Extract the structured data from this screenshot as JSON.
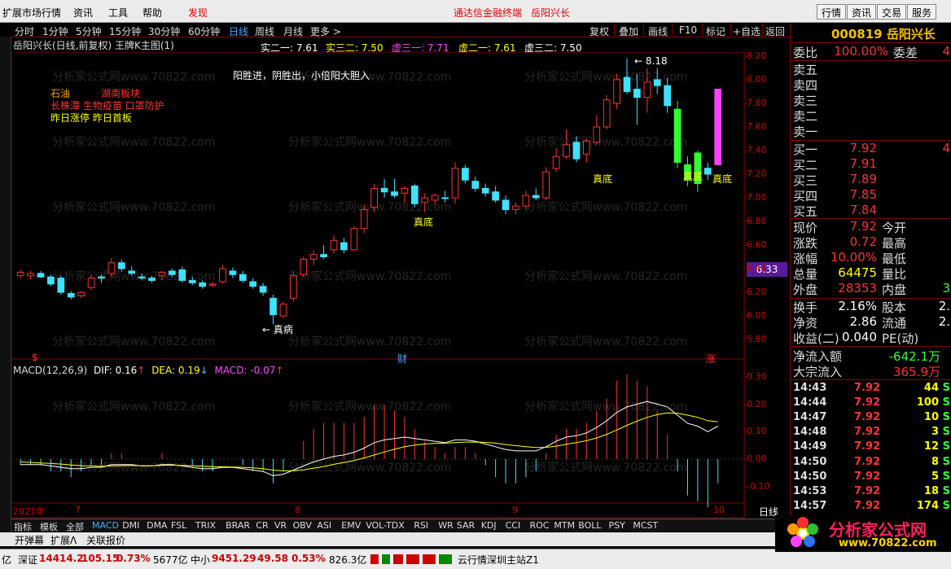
{
  "app": {
    "menus": [
      "扩展市场行情",
      "资讯",
      "工具",
      "帮助",
      "发现"
    ],
    "center_title": "通达信金融终端",
    "center_stock": "岳阳兴长",
    "right_buttons": [
      "行情",
      "资讯",
      "交易",
      "服务"
    ]
  },
  "timeframes": [
    "分时",
    "1分钟",
    "5分钟",
    "15分钟",
    "30分钟",
    "60分钟",
    "日线",
    "周线",
    "月线",
    "更多 >"
  ],
  "selected_tf": "日线",
  "toolbar_right": [
    "复权",
    "叠加",
    "画线",
    "F10",
    "标记",
    "+自选",
    "返回"
  ],
  "chart_title": "岳阳兴长(日线,前复权) 王牌K主图(1)",
  "indicators": [
    {
      "label": "实二一: 7.61",
      "color": "#ffffff"
    },
    {
      "label": "实三二: 7.50",
      "color": "#ffff00"
    },
    {
      "label": "虚三一: 7.71",
      "color": "#ff40ff"
    },
    {
      "label": "虚二一: 7.61",
      "color": "#ffff00"
    },
    {
      "label": "虚三二: 7.50",
      "color": "#ffffff"
    }
  ],
  "notes": {
    "slogan": "阳胜进，阴胜出，小倍阳大胆入",
    "sector1": "石油",
    "sector2": "湖南板块",
    "sector3": "长株潭 生物疫苗 口罩防护",
    "sector4": "昨日涨停 昨日首板",
    "high_label": "8.18",
    "price_box": "6.33",
    "zhendi1": "真底",
    "zhendi2": "真底",
    "zhendi3": "真底",
    "zhendi4": "真底",
    "zhenbing": "真病",
    "marker_s": "$",
    "marker_cai": "财",
    "marker_zhang": "涨"
  },
  "watermark": "分析家公式网www.70822.com",
  "y_axis": [
    "8.20",
    "8.00",
    "7.80",
    "7.60",
    "7.40",
    "7.20",
    "7.00",
    "6.80",
    "6.60",
    "6.40",
    "6.20",
    "6.00",
    "5.80"
  ],
  "macd": {
    "title": "MACD(12,26,9)",
    "dif": "DIF: 0.16",
    "dea": "DEA: 0.19",
    "macd": "MACD: -0.07",
    "axis": [
      "0.30",
      "0.20",
      "0.10",
      "0.00",
      "-0.10"
    ]
  },
  "x_axis": [
    "2021年",
    "7",
    "8",
    "9",
    "10"
  ],
  "x_right": "日线",
  "bottom_tabs": [
    "指标",
    "模板",
    "全部",
    "MACD",
    "DMI",
    "DMA",
    "FSL",
    "TRIX",
    "BRAR",
    "CR",
    "VR",
    "OBV",
    "ASI",
    "EMV",
    "VOL-TDX",
    "RSI",
    "WR",
    "SAR",
    "KDJ",
    "CCI",
    "ROC",
    "MTM",
    "BOLL",
    "PSY",
    "MCST"
  ],
  "selected_tab": "MACD",
  "bottom2": [
    "开弹幕",
    "扩展Λ",
    "关联报价"
  ],
  "status": {
    "a": "亿",
    "sz_label": "深证",
    "sz": "14414.2",
    "sz_chg": "105.15",
    "sz_pct": "0.73%",
    "sz_amt": "5677亿",
    "zx_label": "中小",
    "zx": "9451.29",
    "zx_chg": "49.58",
    "zx_pct": "0.53%",
    "zx_amt": "826.3亿",
    "server": "云行情深圳主站Z1"
  },
  "right_panel": {
    "code": "000819 岳阳兴长",
    "weibi_label": "委比",
    "weibi": "100.00%",
    "weicha_label": "委差",
    "weicha": "4",
    "sells": [
      "卖五",
      "卖四",
      "卖三",
      "卖二",
      "卖一"
    ],
    "buys": [
      {
        "l": "买一",
        "p": "7.92",
        "v": "4"
      },
      {
        "l": "买二",
        "p": "7.91",
        "v": ""
      },
      {
        "l": "买三",
        "p": "7.89",
        "v": ""
      },
      {
        "l": "买四",
        "p": "7.85",
        "v": ""
      },
      {
        "l": "买五",
        "p": "7.84",
        "v": ""
      }
    ],
    "stats": [
      {
        "l": "现价",
        "v": "7.92",
        "c": "red",
        "l2": "今开",
        "v2": ""
      },
      {
        "l": "涨跌",
        "v": "0.72",
        "c": "red",
        "l2": "最高",
        "v2": ""
      },
      {
        "l": "涨幅",
        "v": "10.00%",
        "c": "red",
        "l2": "最低",
        "v2": ""
      },
      {
        "l": "总量",
        "v": "64475",
        "c": "yel",
        "l2": "量比",
        "v2": ""
      },
      {
        "l": "外盘",
        "v": "28353",
        "c": "red",
        "l2": "内盘",
        "v2": "3"
      }
    ],
    "stats2": [
      {
        "l": "换手",
        "v": "2.16%",
        "c": "wht",
        "l2": "股本",
        "v2": "2."
      },
      {
        "l": "净资",
        "v": "2.86",
        "c": "wht",
        "l2": "流通",
        "v2": "2."
      },
      {
        "l": "收益(二)",
        "v": "0.040",
        "c": "wht",
        "l2": "PE(动)",
        "v2": ""
      }
    ],
    "flows": [
      {
        "l": "净流入额",
        "v": "-642.1万",
        "c": "grn"
      },
      {
        "l": "大宗流入",
        "v": "365.9万",
        "c": "red"
      }
    ],
    "ticks": [
      {
        "t": "14:43",
        "p": "7.92",
        "q": "44",
        "f": "S"
      },
      {
        "t": "14:44",
        "p": "7.92",
        "q": "100",
        "f": "S"
      },
      {
        "t": "14:47",
        "p": "7.92",
        "q": "10",
        "f": "S"
      },
      {
        "t": "14:48",
        "p": "7.92",
        "q": "3",
        "f": "S"
      },
      {
        "t": "14:49",
        "p": "7.92",
        "q": "12",
        "f": "S"
      },
      {
        "t": "14:50",
        "p": "7.92",
        "q": "8",
        "f": "S"
      },
      {
        "t": "14:50",
        "p": "7.92",
        "q": "5",
        "f": "S"
      },
      {
        "t": "14:53",
        "p": "7.92",
        "q": "18",
        "f": "S"
      },
      {
        "t": "14:57",
        "p": "7.92",
        "q": "174",
        "f": "S"
      }
    ]
  },
  "logo": {
    "text": "分析家公式网",
    "url": "www.70822.com"
  },
  "chart_data": {
    "type": "candlestick",
    "ylim": [
      5.78,
      8.22
    ],
    "candles": [
      [
        6.37,
        6.39,
        6.32,
        6.34
      ],
      [
        6.34,
        6.38,
        6.31,
        6.36
      ],
      [
        6.36,
        6.38,
        6.32,
        6.33
      ],
      [
        6.33,
        6.35,
        6.25,
        6.27
      ],
      [
        6.32,
        6.34,
        6.18,
        6.2
      ],
      [
        6.19,
        6.21,
        6.14,
        6.16
      ],
      [
        6.17,
        6.21,
        6.15,
        6.2
      ],
      [
        6.24,
        6.35,
        6.22,
        6.32
      ],
      [
        6.32,
        6.35,
        6.28,
        6.33
      ],
      [
        6.36,
        6.49,
        6.33,
        6.45
      ],
      [
        6.45,
        6.48,
        6.37,
        6.4
      ],
      [
        6.38,
        6.42,
        6.34,
        6.36
      ],
      [
        6.33,
        6.36,
        6.3,
        6.32
      ],
      [
        6.32,
        6.34,
        6.28,
        6.3
      ],
      [
        6.34,
        6.38,
        6.3,
        6.37
      ],
      [
        6.38,
        6.4,
        6.33,
        6.35
      ],
      [
        6.39,
        6.42,
        6.28,
        6.3
      ],
      [
        6.3,
        6.33,
        6.26,
        6.28
      ],
      [
        6.28,
        6.3,
        6.23,
        6.25
      ],
      [
        6.26,
        6.29,
        6.24,
        6.27
      ],
      [
        6.29,
        6.43,
        6.27,
        6.4
      ],
      [
        6.38,
        6.41,
        6.32,
        6.35
      ],
      [
        6.35,
        6.38,
        6.28,
        6.3
      ],
      [
        6.29,
        6.32,
        6.23,
        6.25
      ],
      [
        6.25,
        6.28,
        6.17,
        6.2
      ],
      [
        6.15,
        6.18,
        5.93,
        6.01
      ],
      [
        6.0,
        6.12,
        5.98,
        6.1
      ],
      [
        6.15,
        6.38,
        6.12,
        6.34
      ],
      [
        6.35,
        6.5,
        6.33,
        6.48
      ],
      [
        6.48,
        6.56,
        6.43,
        6.52
      ],
      [
        6.52,
        6.6,
        6.48,
        6.5
      ],
      [
        6.56,
        6.68,
        6.53,
        6.64
      ],
      [
        6.62,
        6.66,
        6.53,
        6.56
      ],
      [
        6.56,
        6.76,
        6.55,
        6.74
      ],
      [
        6.74,
        6.94,
        6.7,
        6.9
      ],
      [
        6.92,
        7.12,
        6.88,
        7.08
      ],
      [
        7.08,
        7.16,
        7.0,
        7.05
      ],
      [
        7.05,
        7.16,
        7.0,
        7.02
      ],
      [
        7.04,
        7.1,
        6.96,
        7.08
      ],
      [
        7.1,
        7.12,
        6.92,
        6.95
      ],
      [
        6.96,
        7.04,
        6.88,
        7.0
      ],
      [
        6.98,
        7.04,
        6.94,
        7.02
      ],
      [
        7.0,
        7.06,
        6.96,
        7.0
      ],
      [
        7.0,
        7.3,
        6.95,
        7.25
      ],
      [
        7.25,
        7.28,
        7.12,
        7.15
      ],
      [
        7.14,
        7.18,
        7.05,
        7.08
      ],
      [
        7.08,
        7.12,
        7.01,
        7.04
      ],
      [
        7.05,
        7.1,
        6.96,
        6.98
      ],
      [
        6.98,
        7.02,
        6.86,
        6.9
      ],
      [
        6.9,
        6.96,
        6.86,
        6.93
      ],
      [
        6.93,
        7.06,
        6.9,
        7.02
      ],
      [
        7.02,
        7.08,
        6.98,
        7.0
      ],
      [
        7.0,
        7.26,
        6.98,
        7.22
      ],
      [
        7.25,
        7.42,
        7.22,
        7.35
      ],
      [
        7.35,
        7.58,
        7.33,
        7.45
      ],
      [
        7.47,
        7.52,
        7.3,
        7.33
      ],
      [
        7.37,
        7.5,
        7.3,
        7.48
      ],
      [
        7.47,
        7.7,
        7.45,
        7.6
      ],
      [
        7.6,
        7.87,
        7.58,
        7.83
      ],
      [
        7.8,
        8.05,
        7.75,
        8.0
      ],
      [
        8.02,
        8.18,
        7.88,
        7.9
      ],
      [
        7.92,
        8.05,
        7.62,
        7.85
      ],
      [
        7.85,
        8.1,
        7.72,
        7.98
      ],
      [
        8.0,
        8.1,
        7.88,
        7.95
      ],
      [
        7.95,
        8.02,
        7.72,
        7.78
      ],
      [
        7.75,
        7.82,
        7.25,
        7.3
      ],
      [
        7.28,
        7.35,
        7.1,
        7.15
      ],
      [
        7.12,
        7.4,
        7.05,
        7.38
      ],
      [
        7.25,
        7.3,
        7.15,
        7.2
      ],
      [
        7.28,
        7.92,
        7.28,
        7.92
      ]
    ],
    "colors": [
      "red",
      "red",
      "cyan",
      "cyan",
      "cyan",
      "cyan",
      "red",
      "red",
      "cyan",
      "red",
      "cyan",
      "cyan",
      "cyan",
      "cyan",
      "red",
      "cyan",
      "cyan",
      "cyan",
      "cyan",
      "red",
      "red",
      "cyan",
      "cyan",
      "cyan",
      "cyan",
      "cyan",
      "red",
      "red",
      "red",
      "red",
      "cyan",
      "red",
      "cyan",
      "red",
      "red",
      "red",
      "cyan",
      "cyan",
      "red",
      "cyan",
      "red",
      "red",
      "cyan",
      "red",
      "cyan",
      "cyan",
      "cyan",
      "cyan",
      "cyan",
      "red",
      "red",
      "cyan",
      "red",
      "red",
      "red",
      "cyan",
      "red",
      "red",
      "red",
      "red",
      "cyan",
      "cyan",
      "red",
      "cyan",
      "cyan",
      "green",
      "green",
      "green",
      "cyan",
      "magenta"
    ],
    "macd_dif": [
      -0.02,
      -0.02,
      -0.02,
      -0.025,
      -0.03,
      -0.035,
      -0.035,
      -0.03,
      -0.03,
      -0.02,
      -0.02,
      -0.02,
      -0.025,
      -0.025,
      -0.02,
      -0.02,
      -0.025,
      -0.03,
      -0.035,
      -0.035,
      -0.03,
      -0.03,
      -0.035,
      -0.04,
      -0.045,
      -0.06,
      -0.055,
      -0.04,
      -0.025,
      -0.01,
      0.0,
      0.01,
      0.015,
      0.025,
      0.04,
      0.06,
      0.07,
      0.075,
      0.08,
      0.075,
      0.07,
      0.065,
      0.06,
      0.07,
      0.07,
      0.065,
      0.055,
      0.045,
      0.035,
      0.03,
      0.03,
      0.03,
      0.045,
      0.065,
      0.08,
      0.085,
      0.095,
      0.115,
      0.14,
      0.17,
      0.19,
      0.2,
      0.21,
      0.2,
      0.19,
      0.16,
      0.13,
      0.12,
      0.1,
      0.12
    ],
    "macd_dea": [
      -0.01,
      -0.012,
      -0.014,
      -0.016,
      -0.018,
      -0.021,
      -0.024,
      -0.025,
      -0.026,
      -0.025,
      -0.024,
      -0.023,
      -0.024,
      -0.024,
      -0.023,
      -0.022,
      -0.023,
      -0.024,
      -0.026,
      -0.028,
      -0.028,
      -0.029,
      -0.03,
      -0.032,
      -0.035,
      -0.04,
      -0.043,
      -0.042,
      -0.039,
      -0.033,
      -0.027,
      -0.019,
      -0.012,
      -0.005,
      0.004,
      0.015,
      0.026,
      0.036,
      0.045,
      0.051,
      0.055,
      0.057,
      0.058,
      0.06,
      0.062,
      0.062,
      0.061,
      0.058,
      0.053,
      0.049,
      0.045,
      0.042,
      0.043,
      0.047,
      0.054,
      0.06,
      0.067,
      0.077,
      0.09,
      0.106,
      0.123,
      0.138,
      0.152,
      0.162,
      0.168,
      0.167,
      0.16,
      0.152,
      0.14,
      0.136
    ],
    "macd_hist": [
      -0.01,
      -0.01,
      -0.01,
      -0.02,
      -0.02,
      -0.03,
      -0.02,
      -0.01,
      -0.01,
      0.01,
      0.01,
      0.0,
      0.0,
      0.0,
      0.01,
      0.0,
      0.0,
      -0.01,
      -0.02,
      -0.02,
      0.0,
      0.0,
      -0.01,
      -0.02,
      -0.02,
      -0.04,
      -0.02,
      0.0,
      0.03,
      0.05,
      0.06,
      0.06,
      0.06,
      0.06,
      0.07,
      0.09,
      0.09,
      0.08,
      0.07,
      0.05,
      0.03,
      0.02,
      0.01,
      0.02,
      0.02,
      0.01,
      -0.01,
      -0.03,
      -0.04,
      -0.04,
      -0.03,
      -0.02,
      0.01,
      0.04,
      0.05,
      0.05,
      0.06,
      0.08,
      0.1,
      0.13,
      0.14,
      0.13,
      0.12,
      0.08,
      0.04,
      -0.02,
      -0.06,
      -0.07,
      -0.08,
      -0.04
    ]
  }
}
